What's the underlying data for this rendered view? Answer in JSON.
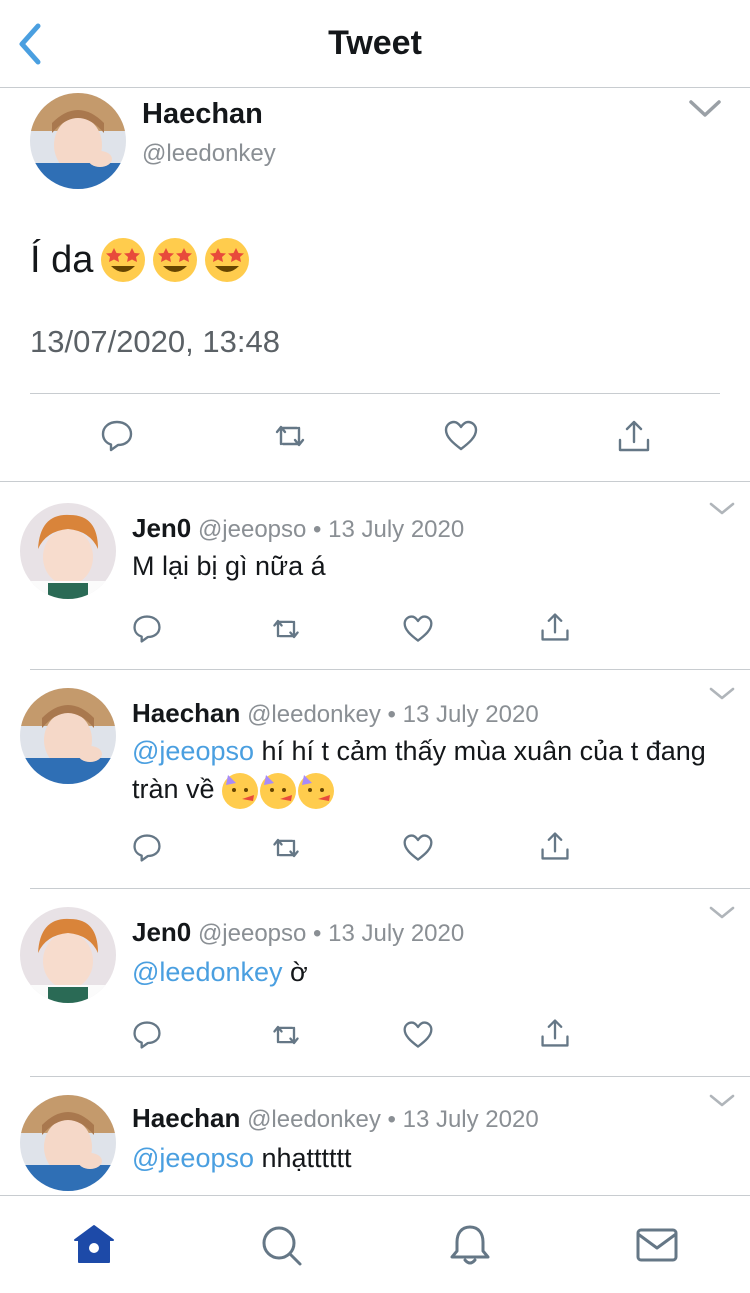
{
  "header": {
    "title": "Tweet"
  },
  "main_tweet": {
    "name": "Haechan",
    "handle": "@leedonkey",
    "text": "Í da",
    "emoji": [
      "star-struck",
      "star-struck",
      "star-struck"
    ],
    "timestamp": "13/07/2020, 13:48"
  },
  "replies": [
    {
      "name": "Jen0",
      "handle": "@jeeopso",
      "date": "13 July 2020",
      "mention": "",
      "text": "M lại bị gì nữa á"
    },
    {
      "name": "Haechan",
      "handle": "@leedonkey",
      "date": "13 July 2020",
      "mention": "@jeeopso",
      "text": " hí hí t cảm thấy mùa xuân của t đang tràn về",
      "emoji": [
        "partying-face",
        "partying-face",
        "partying-face"
      ]
    },
    {
      "name": "Jen0",
      "handle": "@jeeopso",
      "date": "13 July 2020",
      "mention": "@leedonkey",
      "text": " ờ"
    },
    {
      "name": "Haechan",
      "handle": "@leedonkey",
      "date": "13 July 2020",
      "mention": "@jeeopso",
      "text": " nhạtttttt"
    }
  ],
  "separator": " • ",
  "tabs": [
    "home",
    "search",
    "notifications",
    "messages"
  ],
  "colors": {
    "accent": "#1da1f2",
    "mention": "#4a9fe0",
    "active_tab": "#1d4aa8",
    "icon": "#657786"
  }
}
